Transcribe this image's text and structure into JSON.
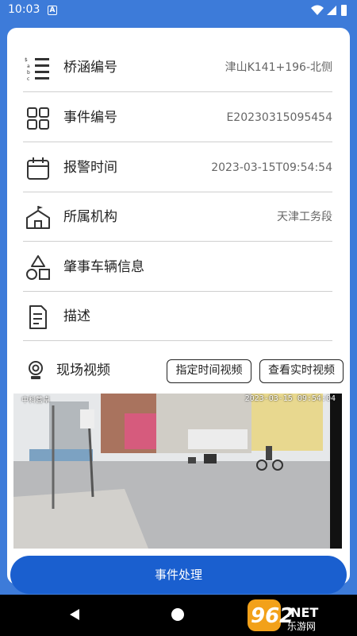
{
  "status_bar": {
    "time": "10:03",
    "notification": "A"
  },
  "details": [
    {
      "label": "桥涵编号",
      "value": "津山K141+196-北侧",
      "icon": "list-abc-icon"
    },
    {
      "label": "事件编号",
      "value": "E20230315095454",
      "icon": "grid-squares-icon"
    },
    {
      "label": "报警时间",
      "value": "2023-03-15T09:54:54",
      "icon": "calendar-icon"
    },
    {
      "label": "所属机构",
      "value": "天津工务段",
      "icon": "building-icon"
    },
    {
      "label": "肇事车辆信息",
      "value": "",
      "icon": "shapes-icon"
    },
    {
      "label": "描述",
      "value": "",
      "icon": "document-icon"
    }
  ],
  "video": {
    "title": "现场视频",
    "btn_specified": "指定时间视频",
    "btn_live": "查看实时视频",
    "timestamp": "2023-03-15 09:54:04",
    "osd_text": "中科营卓"
  },
  "action_button": "事件处理",
  "watermark": {
    "big": "962",
    "suffix": ".NET",
    "sub": "乐游网"
  },
  "colors": {
    "brand_blue": "#3d7bd9",
    "action_blue": "#1a5fcf"
  }
}
